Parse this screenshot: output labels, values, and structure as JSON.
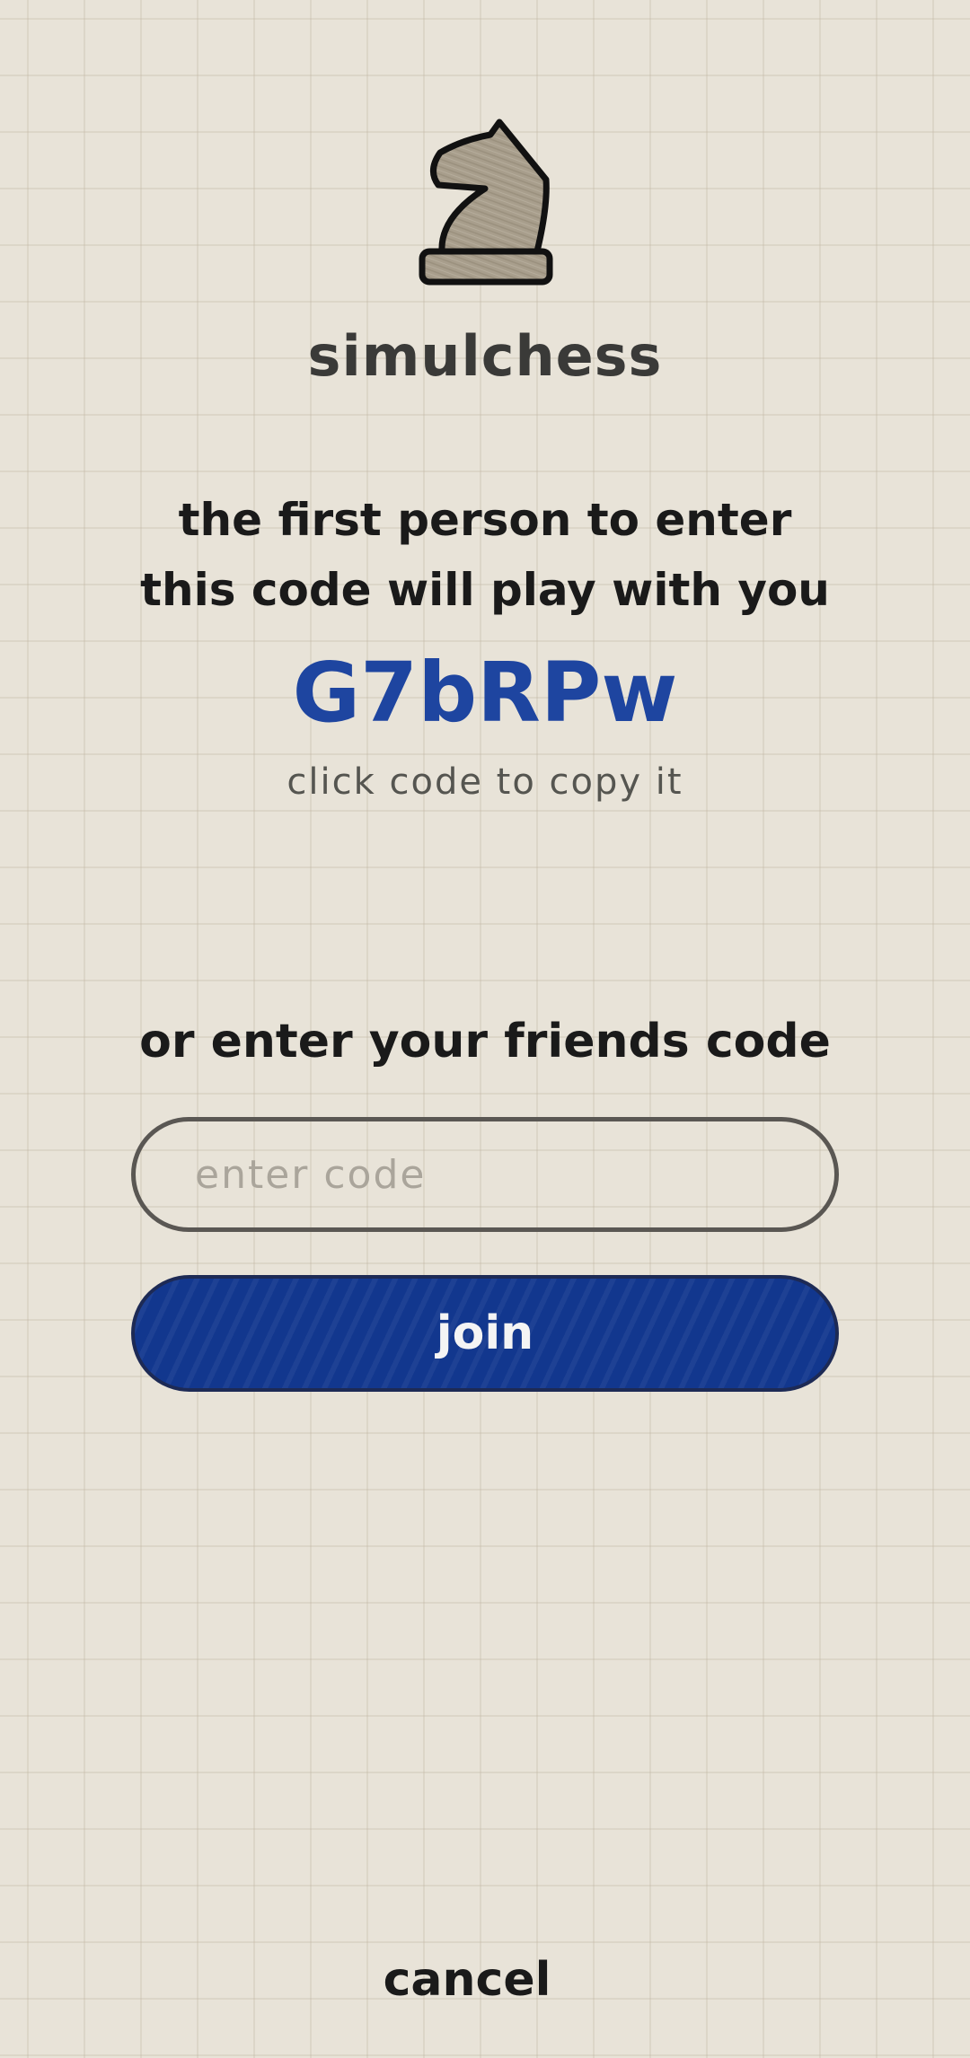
{
  "app": {
    "title": "simulchess",
    "logo_icon": "chess-knight-icon"
  },
  "host": {
    "instructions": "the first person to enter this code will play with you",
    "game_code": "G7bRPw",
    "copy_hint": "click code to copy it"
  },
  "join": {
    "heading": "or enter your friends code",
    "input_placeholder": "enter code",
    "input_value": "",
    "button_label": "join"
  },
  "footer": {
    "cancel_label": "cancel"
  },
  "colors": {
    "background": "#e8e3d8",
    "accent": "#1e45a0",
    "button": "#12378e",
    "knight_fill": "#a89e8c"
  }
}
